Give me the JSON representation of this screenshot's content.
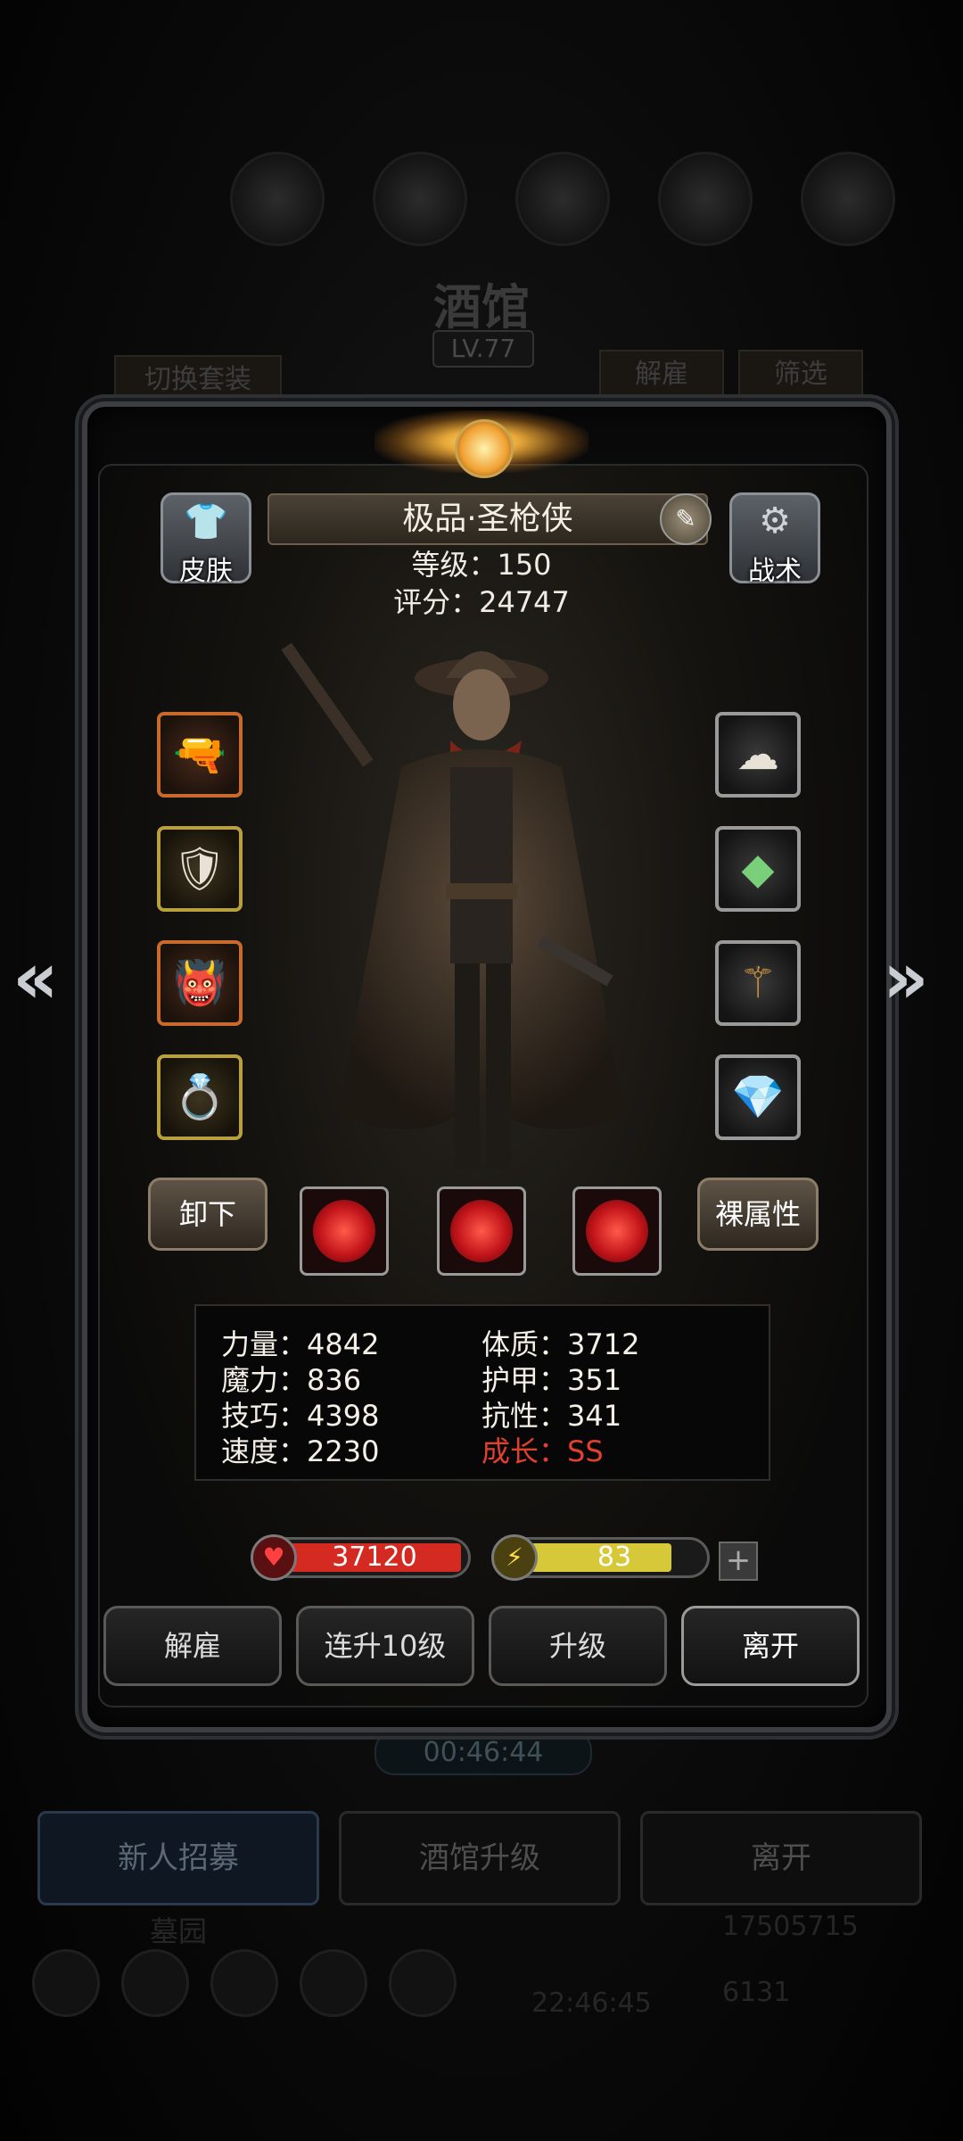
{
  "background": {
    "title": "酒馆",
    "level": "LV.77",
    "switch_outfit": "切换套装",
    "dismiss": "解雇",
    "filter": "筛选",
    "timer": "00:46:44",
    "tabs": [
      "新人招募",
      "酒馆升级",
      "离开"
    ],
    "graveyard": "墓园",
    "gold": "17505715",
    "gems": "6131",
    "clock": "22:46:45"
  },
  "hero": {
    "name": "极品·圣枪侠",
    "level_line": "等级：150",
    "score_line": "评分：24747",
    "skin_label": "皮肤",
    "tactics_label": "战术",
    "unequip_label": "卸下",
    "base_attr_label": "裸属性"
  },
  "attributes": [
    {
      "label": "力量：4842"
    },
    {
      "label": "体质：3712"
    },
    {
      "label": "魔力：836"
    },
    {
      "label": "护甲：351"
    },
    {
      "label": "技巧：4398"
    },
    {
      "label": "抗性：341"
    },
    {
      "label": "速度：2230"
    },
    {
      "label": "成长：SS"
    }
  ],
  "bars": {
    "hp": {
      "value": "37120",
      "fill": 1.0,
      "color": "#d42a22"
    },
    "energy": {
      "value": "83",
      "fill": 0.83,
      "color": "#d7c83a"
    }
  },
  "actions": [
    "解雇",
    "连升10级",
    "升级",
    "离开"
  ],
  "icons": {
    "left_slots": [
      "gun-icon",
      "armor-icon",
      "demon-mask-icon",
      "ring-icon"
    ],
    "right_slots": [
      "cloud-ring-icon",
      "crystal-icon",
      "staff-icon",
      "diamond-icon"
    ],
    "skills": [
      "target-rune-icon",
      "fire-swirl-icon",
      "crosshair-icon"
    ]
  },
  "colors": {
    "accent_gold": "#e8a838",
    "growth_red": "#e0402e"
  }
}
